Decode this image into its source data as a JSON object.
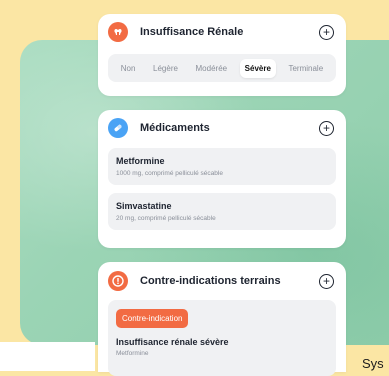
{
  "cards": {
    "renal": {
      "title": "Insuffisance Rénale",
      "icon_color": "#f26b43",
      "levels": [
        "Non",
        "Légère",
        "Modérée",
        "Sévère",
        "Terminale"
      ],
      "selected": "Sévère"
    },
    "meds": {
      "title": "Médicaments",
      "icon_color": "#4aa3f5",
      "items": [
        {
          "name": "Metformine",
          "desc": "1000 mg, comprimé pelliculé sécable"
        },
        {
          "name": "Simvastatine",
          "desc": "20 mg, comprimé pelliculé sécable"
        }
      ]
    },
    "contra": {
      "title": "Contre-indications terrains",
      "icon_color": "#f26b43",
      "badge": "Contre-indication",
      "item_title": "Insuffisance rénale sévère",
      "item_sub": "Metformine"
    }
  },
  "plus_symbol": "+",
  "corner_text": "Sys"
}
